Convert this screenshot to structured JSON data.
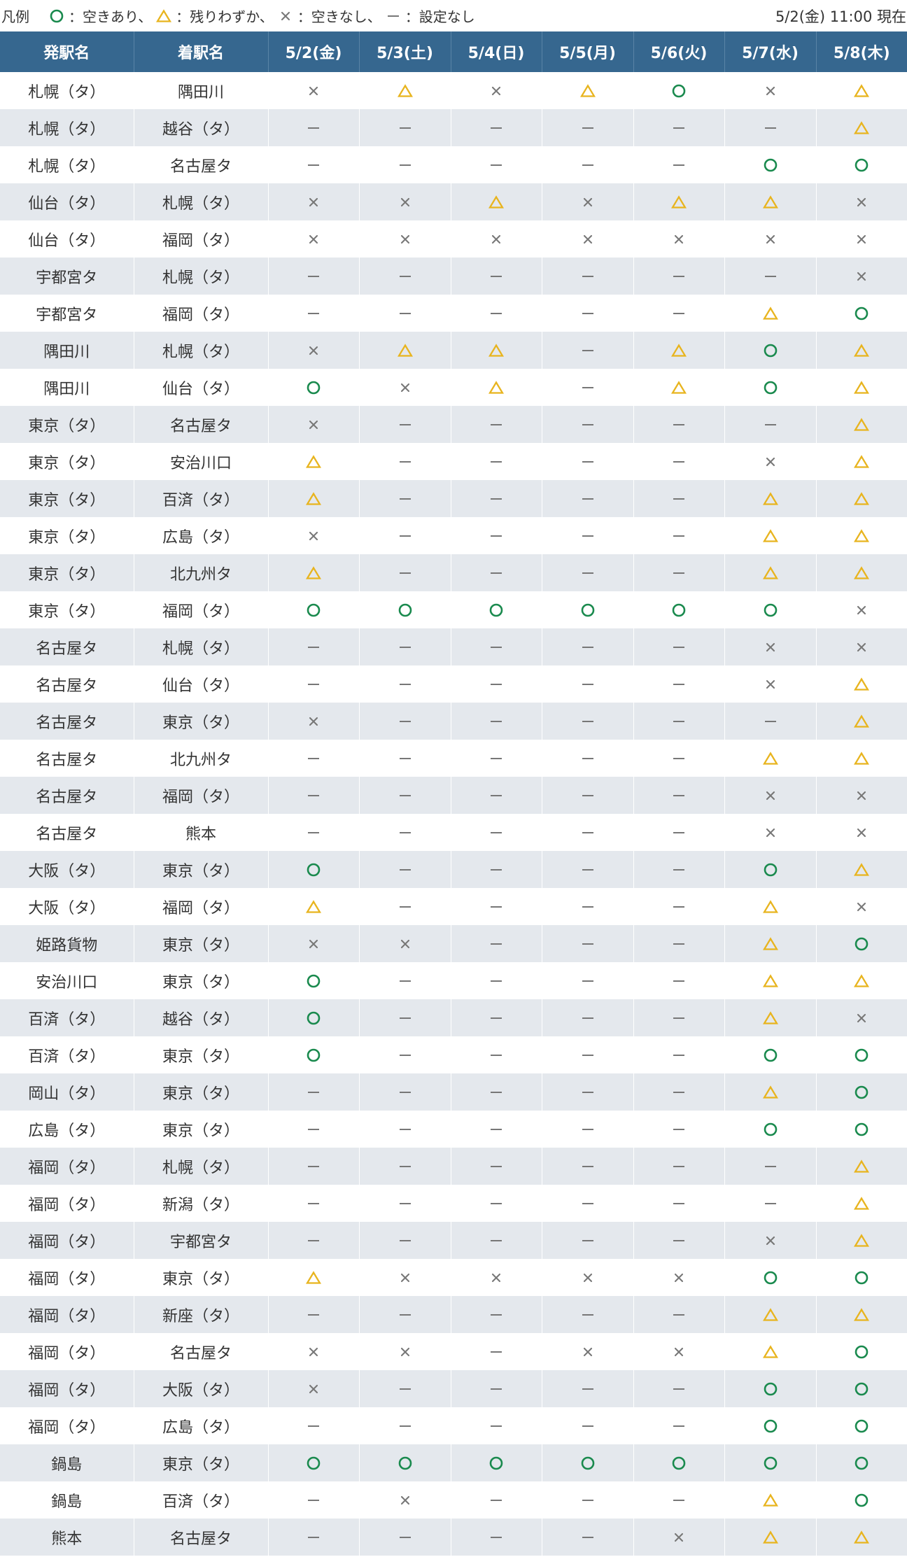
{
  "legend": {
    "title": "凡例",
    "items": [
      {
        "symbol": "o",
        "label": "：空きあり、"
      },
      {
        "symbol": "t",
        "label": "：残りわずか、"
      },
      {
        "symbol": "x",
        "label": "：空きなし、"
      },
      {
        "symbol": "d",
        "label": "：設定なし"
      }
    ]
  },
  "timestamp": "5/2(金) 11:00 現在",
  "colors": {
    "header_bg": "#36678f",
    "available": "#1a8a4e",
    "few_left": "#e8b41e",
    "full": "#777777",
    "none": "#777777",
    "row_alt": "#e4e8ed"
  },
  "table": {
    "headers": [
      "発駅名",
      "着駅名",
      "5/2(金)",
      "5/3(土)",
      "5/4(日)",
      "5/5(月)",
      "5/6(火)",
      "5/7(水)",
      "5/8(木)"
    ],
    "rows": [
      {
        "from": "札幌（タ）",
        "to": "隅田川",
        "s": [
          "x",
          "t",
          "x",
          "t",
          "o",
          "x",
          "t"
        ]
      },
      {
        "from": "札幌（タ）",
        "to": "越谷（タ）",
        "s": [
          "d",
          "d",
          "d",
          "d",
          "d",
          "d",
          "t"
        ]
      },
      {
        "from": "札幌（タ）",
        "to": "名古屋タ",
        "s": [
          "d",
          "d",
          "d",
          "d",
          "d",
          "o",
          "o"
        ]
      },
      {
        "from": "仙台（タ）",
        "to": "札幌（タ）",
        "s": [
          "x",
          "x",
          "t",
          "x",
          "t",
          "t",
          "x"
        ]
      },
      {
        "from": "仙台（タ）",
        "to": "福岡（タ）",
        "s": [
          "x",
          "x",
          "x",
          "x",
          "x",
          "x",
          "x"
        ]
      },
      {
        "from": "宇都宮タ",
        "to": "札幌（タ）",
        "s": [
          "d",
          "d",
          "d",
          "d",
          "d",
          "d",
          "x"
        ]
      },
      {
        "from": "宇都宮タ",
        "to": "福岡（タ）",
        "s": [
          "d",
          "d",
          "d",
          "d",
          "d",
          "t",
          "o"
        ]
      },
      {
        "from": "隅田川",
        "to": "札幌（タ）",
        "s": [
          "x",
          "t",
          "t",
          "d",
          "t",
          "o",
          "t"
        ]
      },
      {
        "from": "隅田川",
        "to": "仙台（タ）",
        "s": [
          "o",
          "x",
          "t",
          "d",
          "t",
          "o",
          "t"
        ]
      },
      {
        "from": "東京（タ）",
        "to": "名古屋タ",
        "s": [
          "x",
          "d",
          "d",
          "d",
          "d",
          "d",
          "t"
        ]
      },
      {
        "from": "東京（タ）",
        "to": "安治川口",
        "s": [
          "t",
          "d",
          "d",
          "d",
          "d",
          "x",
          "t"
        ]
      },
      {
        "from": "東京（タ）",
        "to": "百済（タ）",
        "s": [
          "t",
          "d",
          "d",
          "d",
          "d",
          "t",
          "t"
        ]
      },
      {
        "from": "東京（タ）",
        "to": "広島（タ）",
        "s": [
          "x",
          "d",
          "d",
          "d",
          "d",
          "t",
          "t"
        ]
      },
      {
        "from": "東京（タ）",
        "to": "北九州タ",
        "s": [
          "t",
          "d",
          "d",
          "d",
          "d",
          "t",
          "t"
        ]
      },
      {
        "from": "東京（タ）",
        "to": "福岡（タ）",
        "s": [
          "o",
          "o",
          "o",
          "o",
          "o",
          "o",
          "x"
        ]
      },
      {
        "from": "名古屋タ",
        "to": "札幌（タ）",
        "s": [
          "d",
          "d",
          "d",
          "d",
          "d",
          "x",
          "x"
        ]
      },
      {
        "from": "名古屋タ",
        "to": "仙台（タ）",
        "s": [
          "d",
          "d",
          "d",
          "d",
          "d",
          "x",
          "t"
        ]
      },
      {
        "from": "名古屋タ",
        "to": "東京（タ）",
        "s": [
          "x",
          "d",
          "d",
          "d",
          "d",
          "d",
          "t"
        ]
      },
      {
        "from": "名古屋タ",
        "to": "北九州タ",
        "s": [
          "d",
          "d",
          "d",
          "d",
          "d",
          "t",
          "t"
        ]
      },
      {
        "from": "名古屋タ",
        "to": "福岡（タ）",
        "s": [
          "d",
          "d",
          "d",
          "d",
          "d",
          "x",
          "x"
        ]
      },
      {
        "from": "名古屋タ",
        "to": "熊本",
        "s": [
          "d",
          "d",
          "d",
          "d",
          "d",
          "x",
          "x"
        ]
      },
      {
        "from": "大阪（タ）",
        "to": "東京（タ）",
        "s": [
          "o",
          "d",
          "d",
          "d",
          "d",
          "o",
          "t"
        ]
      },
      {
        "from": "大阪（タ）",
        "to": "福岡（タ）",
        "s": [
          "t",
          "d",
          "d",
          "d",
          "d",
          "t",
          "x"
        ]
      },
      {
        "from": "姫路貨物",
        "to": "東京（タ）",
        "s": [
          "x",
          "x",
          "d",
          "d",
          "d",
          "t",
          "o"
        ]
      },
      {
        "from": "安治川口",
        "to": "東京（タ）",
        "s": [
          "o",
          "d",
          "d",
          "d",
          "d",
          "t",
          "t"
        ]
      },
      {
        "from": "百済（タ）",
        "to": "越谷（タ）",
        "s": [
          "o",
          "d",
          "d",
          "d",
          "d",
          "t",
          "x"
        ]
      },
      {
        "from": "百済（タ）",
        "to": "東京（タ）",
        "s": [
          "o",
          "d",
          "d",
          "d",
          "d",
          "o",
          "o"
        ]
      },
      {
        "from": "岡山（タ）",
        "to": "東京（タ）",
        "s": [
          "d",
          "d",
          "d",
          "d",
          "d",
          "t",
          "o"
        ]
      },
      {
        "from": "広島（タ）",
        "to": "東京（タ）",
        "s": [
          "d",
          "d",
          "d",
          "d",
          "d",
          "o",
          "o"
        ]
      },
      {
        "from": "福岡（タ）",
        "to": "札幌（タ）",
        "s": [
          "d",
          "d",
          "d",
          "d",
          "d",
          "d",
          "t"
        ]
      },
      {
        "from": "福岡（タ）",
        "to": "新潟（タ）",
        "s": [
          "d",
          "d",
          "d",
          "d",
          "d",
          "d",
          "t"
        ]
      },
      {
        "from": "福岡（タ）",
        "to": "宇都宮タ",
        "s": [
          "d",
          "d",
          "d",
          "d",
          "d",
          "x",
          "t"
        ]
      },
      {
        "from": "福岡（タ）",
        "to": "東京（タ）",
        "s": [
          "t",
          "x",
          "x",
          "x",
          "x",
          "o",
          "o"
        ]
      },
      {
        "from": "福岡（タ）",
        "to": "新座（タ）",
        "s": [
          "d",
          "d",
          "d",
          "d",
          "d",
          "t",
          "t"
        ]
      },
      {
        "from": "福岡（タ）",
        "to": "名古屋タ",
        "s": [
          "x",
          "x",
          "d",
          "x",
          "x",
          "t",
          "o"
        ]
      },
      {
        "from": "福岡（タ）",
        "to": "大阪（タ）",
        "s": [
          "x",
          "d",
          "d",
          "d",
          "d",
          "o",
          "o"
        ]
      },
      {
        "from": "福岡（タ）",
        "to": "広島（タ）",
        "s": [
          "d",
          "d",
          "d",
          "d",
          "d",
          "o",
          "o"
        ]
      },
      {
        "from": "鍋島",
        "to": "東京（タ）",
        "s": [
          "o",
          "o",
          "o",
          "o",
          "o",
          "o",
          "o"
        ]
      },
      {
        "from": "鍋島",
        "to": "百済（タ）",
        "s": [
          "d",
          "x",
          "d",
          "d",
          "d",
          "t",
          "o"
        ]
      },
      {
        "from": "熊本",
        "to": "名古屋タ",
        "s": [
          "d",
          "d",
          "d",
          "d",
          "x",
          "t",
          "t"
        ]
      }
    ]
  }
}
